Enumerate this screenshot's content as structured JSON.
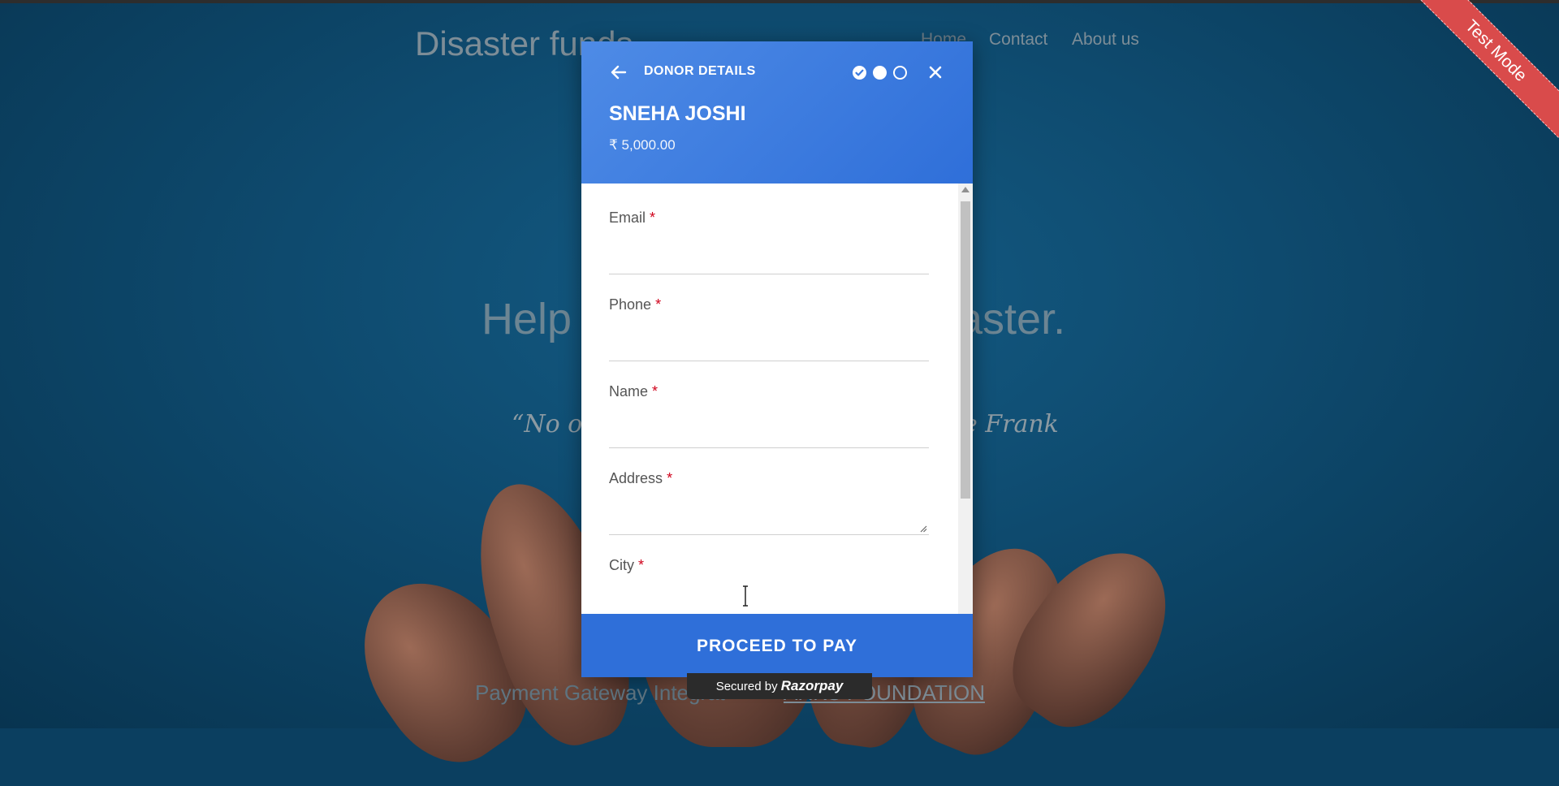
{
  "background": {
    "site_title": "Disaster funds",
    "nav": [
      "Home",
      "Contact",
      "About us"
    ],
    "hero_left": "Help",
    "hero_right": "aster.",
    "quote_left": "“No on",
    "quote_right": "e Frank",
    "footer_text": "Payment Gateway Integrat",
    "footer_link": "ARKS FOUNDATION"
  },
  "ribbon": {
    "label": "Test Mode",
    "color": "#d94b4b"
  },
  "modal": {
    "header_title": "DONOR DETAILS",
    "steps": [
      "done",
      "active",
      "todo"
    ],
    "donor_name": "SNEHA JOSHI",
    "amount": "₹ 5,000.00",
    "fields": [
      {
        "label": "Email",
        "required": "*"
      },
      {
        "label": "Phone",
        "required": "*"
      },
      {
        "label": "Name",
        "required": "*"
      },
      {
        "label": "Address",
        "required": "*"
      },
      {
        "label": "City",
        "required": "*"
      }
    ],
    "pay_button": "PROCEED TO PAY",
    "secured_by": "Secured by",
    "brand": "Razorpay"
  },
  "colors": {
    "header": "#3b7be0",
    "button": "#2f6fd9",
    "required": "#d0021b"
  }
}
